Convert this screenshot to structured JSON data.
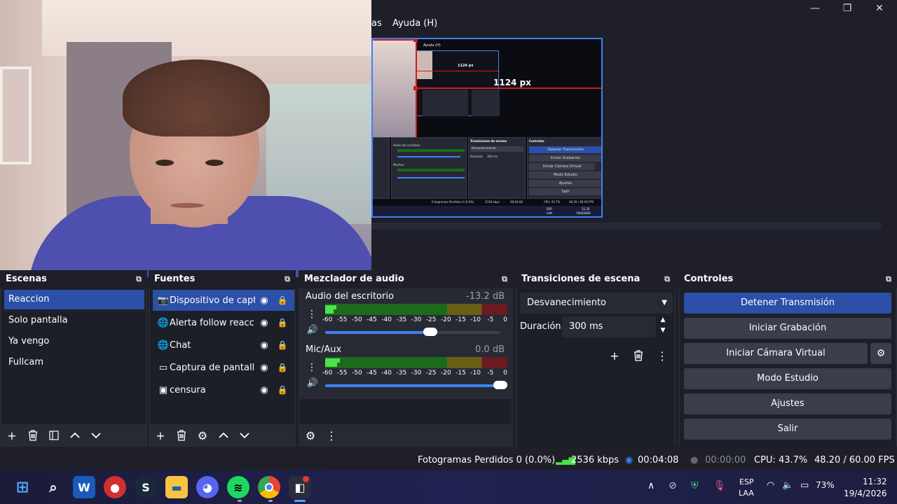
{
  "window": {
    "menu_partial": "as",
    "menu_help": "Ayuda (H)",
    "minimize": "—",
    "maximize": "❐",
    "close": "✕"
  },
  "preview": {
    "measure_label_horizontal": "1124 px",
    "measure_label_vertical": "px",
    "mini_menu_label": "Ayuda (H)",
    "mini_inner_label": "1124 px",
    "mini_docks": {
      "mixer_title": "Mezclador de audio",
      "mixer_ch1": "Audio del escritorio",
      "mixer_ch2": "Mic/Aux",
      "transitions_title": "Transiciones de escena",
      "transition_select": "Desvanecimiento",
      "duration_label": "Duración",
      "duration_value": "300 ms",
      "controls_title": "Controles",
      "buttons": [
        "Detener Transmisión",
        "Iniciar Grabación",
        "Iniciar Cámara Virtual",
        "Modo Estudio",
        "Ajustes",
        "Salir"
      ],
      "status": "Fotogramas Perdidos 0 (0.0%)",
      "kbps": "2336 kbps",
      "time": "00:04:08",
      "cpu": "CPU: 43.7%",
      "fps": "48.20 / 60.00 FPS",
      "clock_time": "11:32",
      "clock_date": "19/4/2026",
      "lang": "ESP",
      "lang2": "LAA"
    }
  },
  "scenes": {
    "title": "Escenas",
    "items": [
      "Reaccion",
      "Solo pantalla",
      "Ya vengo",
      "Fullcam"
    ],
    "active_index": 0
  },
  "sources": {
    "title": "Fuentes",
    "items": [
      {
        "label": "Dispositivo de captu",
        "icon": "camera-icon"
      },
      {
        "label": "Alerta follow reaccic",
        "icon": "globe-icon"
      },
      {
        "label": "Chat",
        "icon": "globe-icon"
      },
      {
        "label": "Captura de pantalla",
        "icon": "monitor-icon"
      },
      {
        "label": "censura",
        "icon": "image-icon"
      }
    ],
    "active_index": 0
  },
  "mixer": {
    "title": "Mezclador de audio",
    "channels": [
      {
        "name": "Audio del escritorio",
        "db": "-13.2 dB",
        "level": 0.06,
        "volume": 0.6
      },
      {
        "name": "Mic/Aux",
        "db": "0.0 dB",
        "level": 0.08,
        "volume": 1.0
      }
    ],
    "ticks": [
      "-60",
      "-55",
      "-50",
      "-45",
      "-40",
      "-35",
      "-30",
      "-25",
      "-20",
      "-15",
      "-10",
      "-5",
      "0"
    ]
  },
  "transitions": {
    "title": "Transiciones de escena",
    "selected": "Desvanecimiento",
    "duration_label": "Duración",
    "duration_value": "300 ms"
  },
  "controls": {
    "title": "Controles",
    "stop_stream": "Detener Transmisión",
    "start_recording": "Iniciar Grabación",
    "start_virtual_cam": "Iniciar Cámara Virtual",
    "studio_mode": "Modo Estudio",
    "settings": "Ajustes",
    "exit": "Salir"
  },
  "status": {
    "dropped_frames": "Fotogramas Perdidos 0 (0.0%)",
    "bitrate": "2536 kbps",
    "stream_time": "00:04:08",
    "record_time": "00:00:00",
    "cpu": "CPU: 43.7%",
    "fps": "48.20 / 60.00 FPS"
  },
  "taskbar": {
    "lang_line1": "ESP",
    "lang_line2": "LAA",
    "battery": "73%",
    "time": "11:32",
    "date": "19/4/2026",
    "apps": [
      "start-icon",
      "search-icon",
      "word-icon",
      "app-red-icon",
      "steam-icon",
      "explorer-icon",
      "discord-icon",
      "spotify-icon",
      "chrome-icon",
      "obs-icon"
    ]
  },
  "colors": {
    "accent": "#2c4fa8",
    "preview_border": "#3b82f6",
    "guide_red": "#d41a1a",
    "meter_green": "#4ae34a"
  }
}
